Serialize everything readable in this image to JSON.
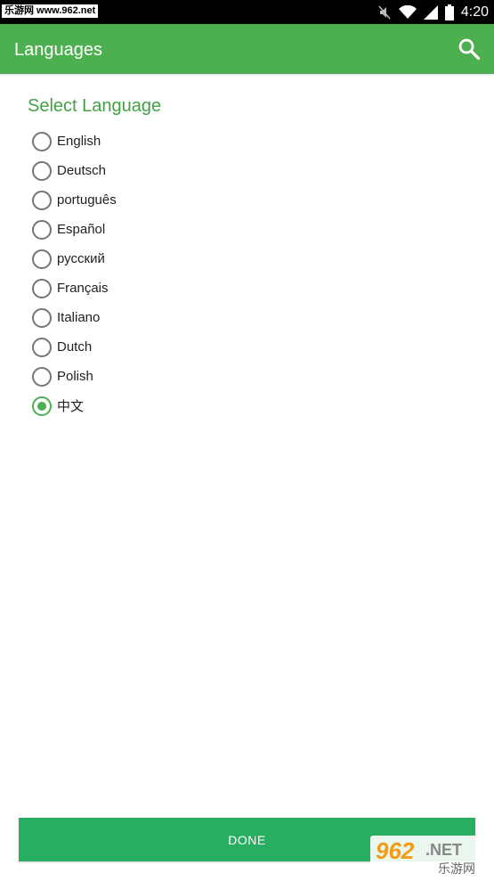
{
  "status_bar": {
    "badge": "乐游网 www.962.net",
    "time": "4:20"
  },
  "app_bar": {
    "title": "Languages",
    "search_icon": "search-icon"
  },
  "section_title": "Select Language",
  "languages": [
    {
      "label": "English",
      "checked": false
    },
    {
      "label": "Deutsch",
      "checked": false
    },
    {
      "label": "português",
      "checked": false
    },
    {
      "label": "Español",
      "checked": false
    },
    {
      "label": "русский",
      "checked": false
    },
    {
      "label": "Français",
      "checked": false
    },
    {
      "label": "Italiano",
      "checked": false
    },
    {
      "label": "Dutch",
      "checked": false
    },
    {
      "label": "Polish",
      "checked": false
    },
    {
      "label": "中文",
      "checked": true
    }
  ],
  "done_label": "DONE",
  "watermark": {
    "logo_text": "962.NET",
    "site_text": "乐游网"
  },
  "colors": {
    "app_bar": "#4caf50",
    "accent": "#43a047",
    "done_button": "#27ae60"
  }
}
